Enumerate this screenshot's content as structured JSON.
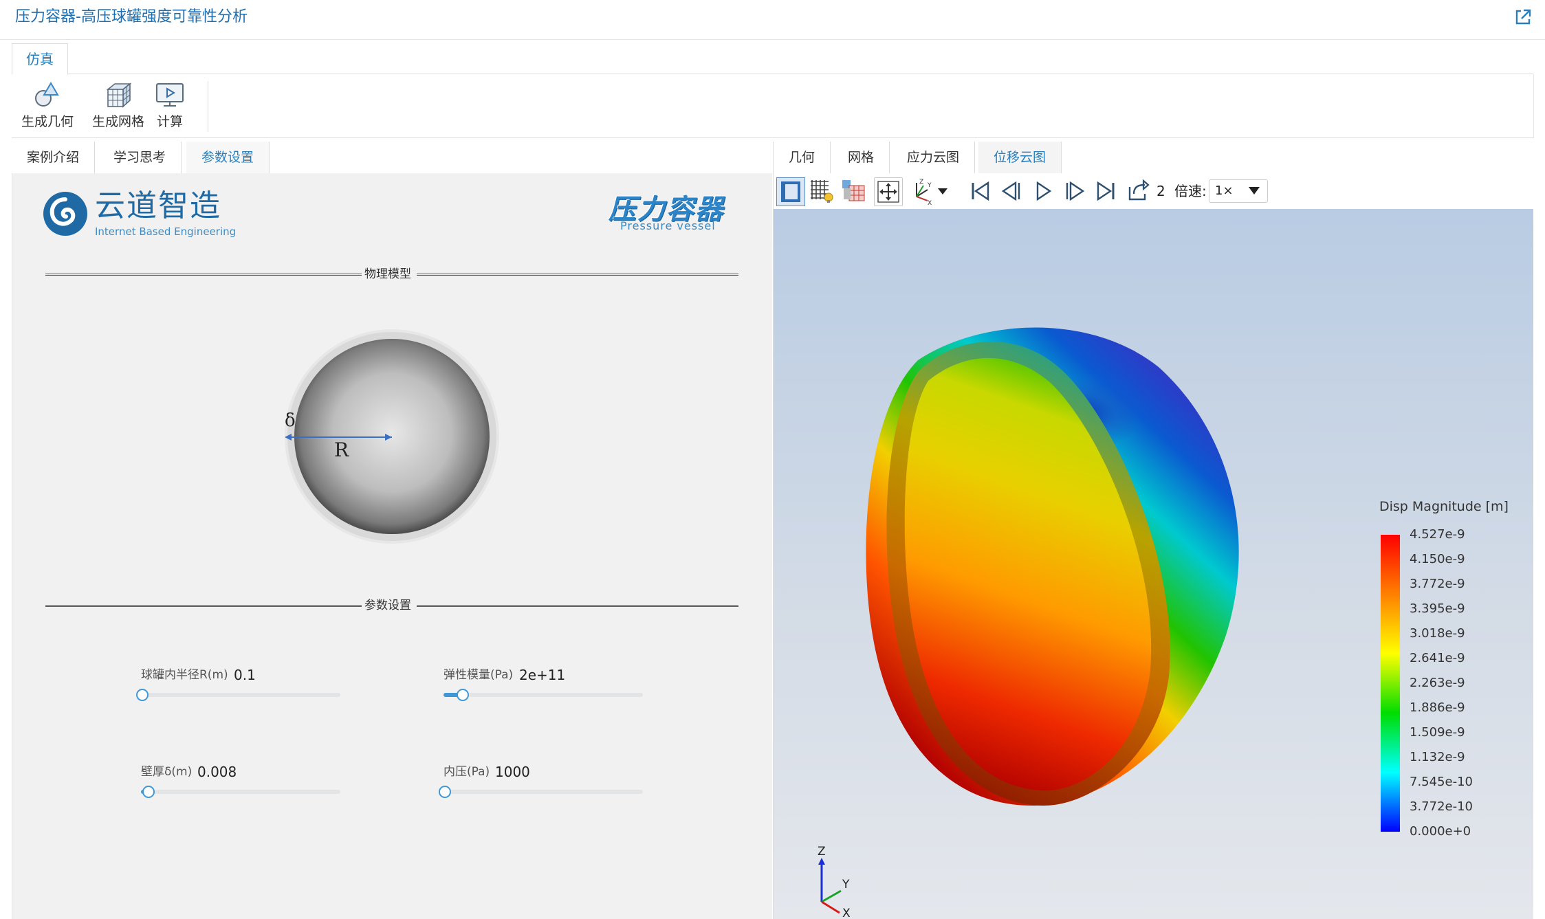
{
  "app": {
    "title": "压力容器-高压球罐强度可靠性分析",
    "ribbon_tab": "仿真",
    "ribbon_buttons": [
      {
        "label": "生成几何",
        "icon": "geometry-icon"
      },
      {
        "label": "生成网格",
        "icon": "mesh-icon"
      },
      {
        "label": "计算",
        "icon": "compute-icon"
      }
    ]
  },
  "left": {
    "tabs": [
      "案例介绍",
      "学习思考",
      "参数设置"
    ],
    "active_tab": 2,
    "logo_cn": "云道智造",
    "logo_en": "Internet Based Engineering",
    "brand_cn": "压力容器",
    "brand_en": "Pressure vessel",
    "section_model": "物理模型",
    "section_params": "参数设置",
    "diagram": {
      "delta_symbol": "δ",
      "radius_symbol": "R"
    },
    "params": [
      {
        "label": "球罐内半径R(m)",
        "value": "0.1",
        "fraction": 0.0
      },
      {
        "label": "弹性模量(Pa)",
        "value": "2e+11",
        "fraction": 0.09
      },
      {
        "label": "壁厚δ(m)",
        "value": "0.008",
        "fraction": 0.03
      },
      {
        "label": "内压(Pa)",
        "value": "1000",
        "fraction": 0.0
      }
    ]
  },
  "right": {
    "tabs": [
      "几何",
      "网格",
      "应力云图",
      "位移云图"
    ],
    "active_tab": 3,
    "frame": "2",
    "speed_label": "倍速:",
    "speed_value": "1×",
    "legend": {
      "title": "Disp Magnitude [m]",
      "ticks": [
        "4.527e-9",
        "4.150e-9",
        "3.772e-9",
        "3.395e-9",
        "3.018e-9",
        "2.641e-9",
        "2.263e-9",
        "1.886e-9",
        "1.509e-9",
        "1.132e-9",
        "7.545e-10",
        "3.772e-10",
        "0.000e+0"
      ],
      "colors": [
        "#ff0000",
        "#ff8000",
        "#ffff00",
        "#00dd00",
        "#00ffff",
        "#0000ff"
      ]
    },
    "triad": {
      "z": "Z",
      "y": "Y",
      "x": "X"
    }
  }
}
